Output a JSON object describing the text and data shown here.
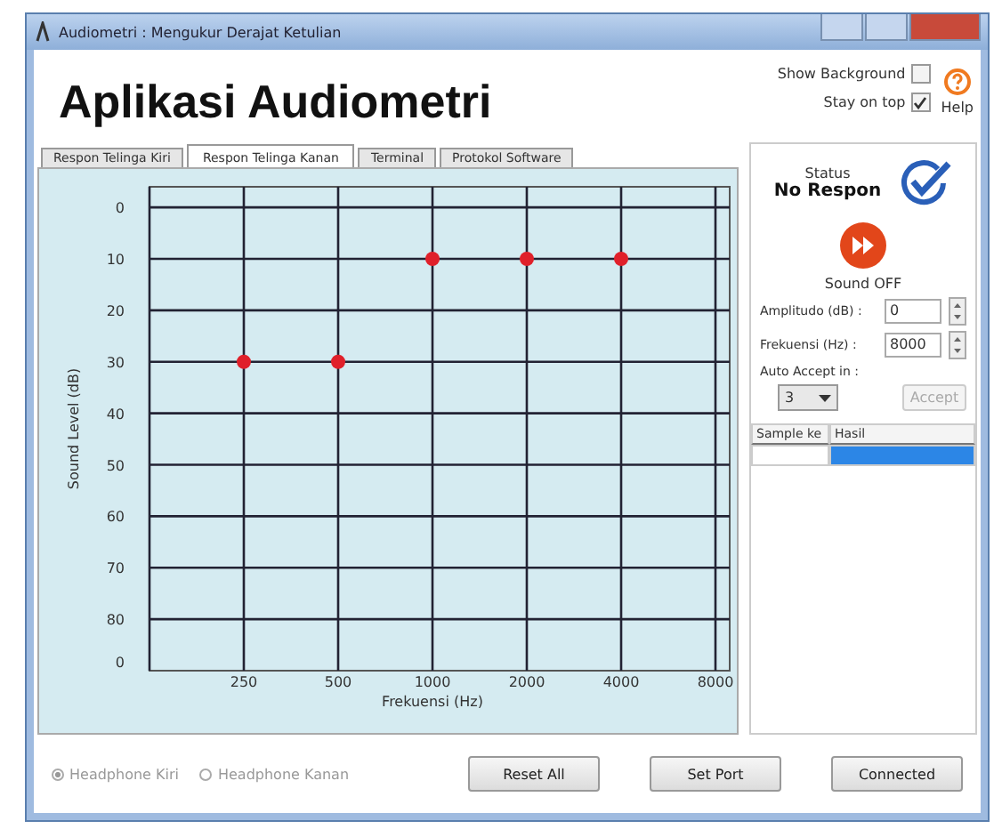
{
  "window": {
    "title": "Audiometri : Mengukur Derajat Ketulian"
  },
  "header": {
    "title": "Aplikasi Audiometri"
  },
  "options": [
    {
      "label": "Show Background",
      "checked": false
    },
    {
      "label": "Stay on top",
      "checked": true
    }
  ],
  "help": {
    "label": "Help"
  },
  "tabs": [
    {
      "label": "Respon Telinga Kiri",
      "selected": false
    },
    {
      "label": "Respon Telinga Kanan",
      "selected": true
    },
    {
      "label": "Terminal",
      "selected": false
    },
    {
      "label": "Protokol Software",
      "selected": false
    }
  ],
  "chart_data": {
    "type": "scatter",
    "xlabel": "Frekuensi (Hz)",
    "ylabel": "Sound Level (dB)",
    "categories": [
      "0",
      "250",
      "500",
      "1000",
      "2000",
      "4000",
      "8000"
    ],
    "series": [
      {
        "color": "#e0202a",
        "values": [
          null,
          30,
          30,
          10,
          10,
          10,
          null
        ]
      }
    ],
    "ylim": [
      90,
      -4
    ],
    "grid": true,
    "yticks": [
      0,
      10,
      20,
      30,
      40,
      50,
      60,
      70,
      80
    ]
  },
  "status": {
    "label": "Status",
    "value": "No Respon"
  },
  "sound": {
    "label": "Sound OFF"
  },
  "fields": [
    {
      "label": "Amplitudo (dB) :",
      "value": "0"
    },
    {
      "label": "Frekuensi (Hz) :",
      "value": "8000"
    }
  ],
  "auto_accept": {
    "label": "Auto Accept in :",
    "value": "3"
  },
  "accept_button": {
    "label": "Accept",
    "disabled": true
  },
  "table": {
    "columns": [
      "Sample ke",
      "Hasil"
    ],
    "rows": [
      {
        "selected": true
      }
    ]
  },
  "headphones": [
    {
      "label": "Headphone Kiri",
      "selected": true
    },
    {
      "label": "Headphone Kanan",
      "selected": false
    }
  ],
  "buttons": [
    "Reset All",
    "Set Port",
    "Connected"
  ]
}
